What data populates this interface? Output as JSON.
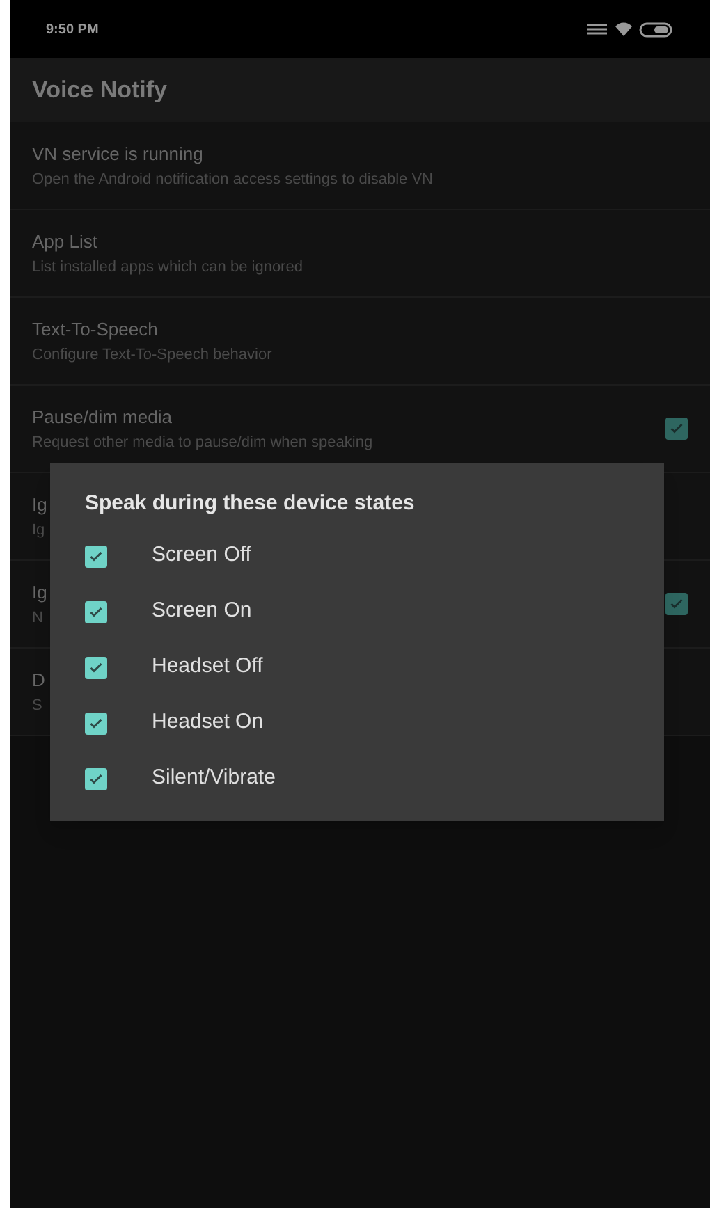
{
  "status_bar": {
    "time": "9:50 PM"
  },
  "app_bar": {
    "title": "Voice Notify"
  },
  "settings": [
    {
      "title": "VN service is running",
      "summary": "Open the Android notification access settings to disable VN"
    },
    {
      "title": "App List",
      "summary": "List installed apps which can be ignored"
    },
    {
      "title": "Text-To-Speech",
      "summary": "Configure Text-To-Speech behavior"
    },
    {
      "title": "Pause/dim media",
      "summary": "Request other media to pause/dim when speaking",
      "kind": "checkbox",
      "checked": true
    },
    {
      "title": "Ig",
      "summary": "Ig"
    },
    {
      "title": "Ig",
      "summary": "N",
      "kind": "checkbox",
      "checked": true
    },
    {
      "title": "D",
      "summary": "S"
    }
  ],
  "dialog": {
    "title": "Speak during these device states",
    "options": [
      {
        "label": "Screen Off",
        "checked": true
      },
      {
        "label": "Screen On",
        "checked": true
      },
      {
        "label": "Headset Off",
        "checked": true
      },
      {
        "label": "Headset On",
        "checked": true
      },
      {
        "label": "Silent/Vibrate",
        "checked": true
      }
    ]
  }
}
